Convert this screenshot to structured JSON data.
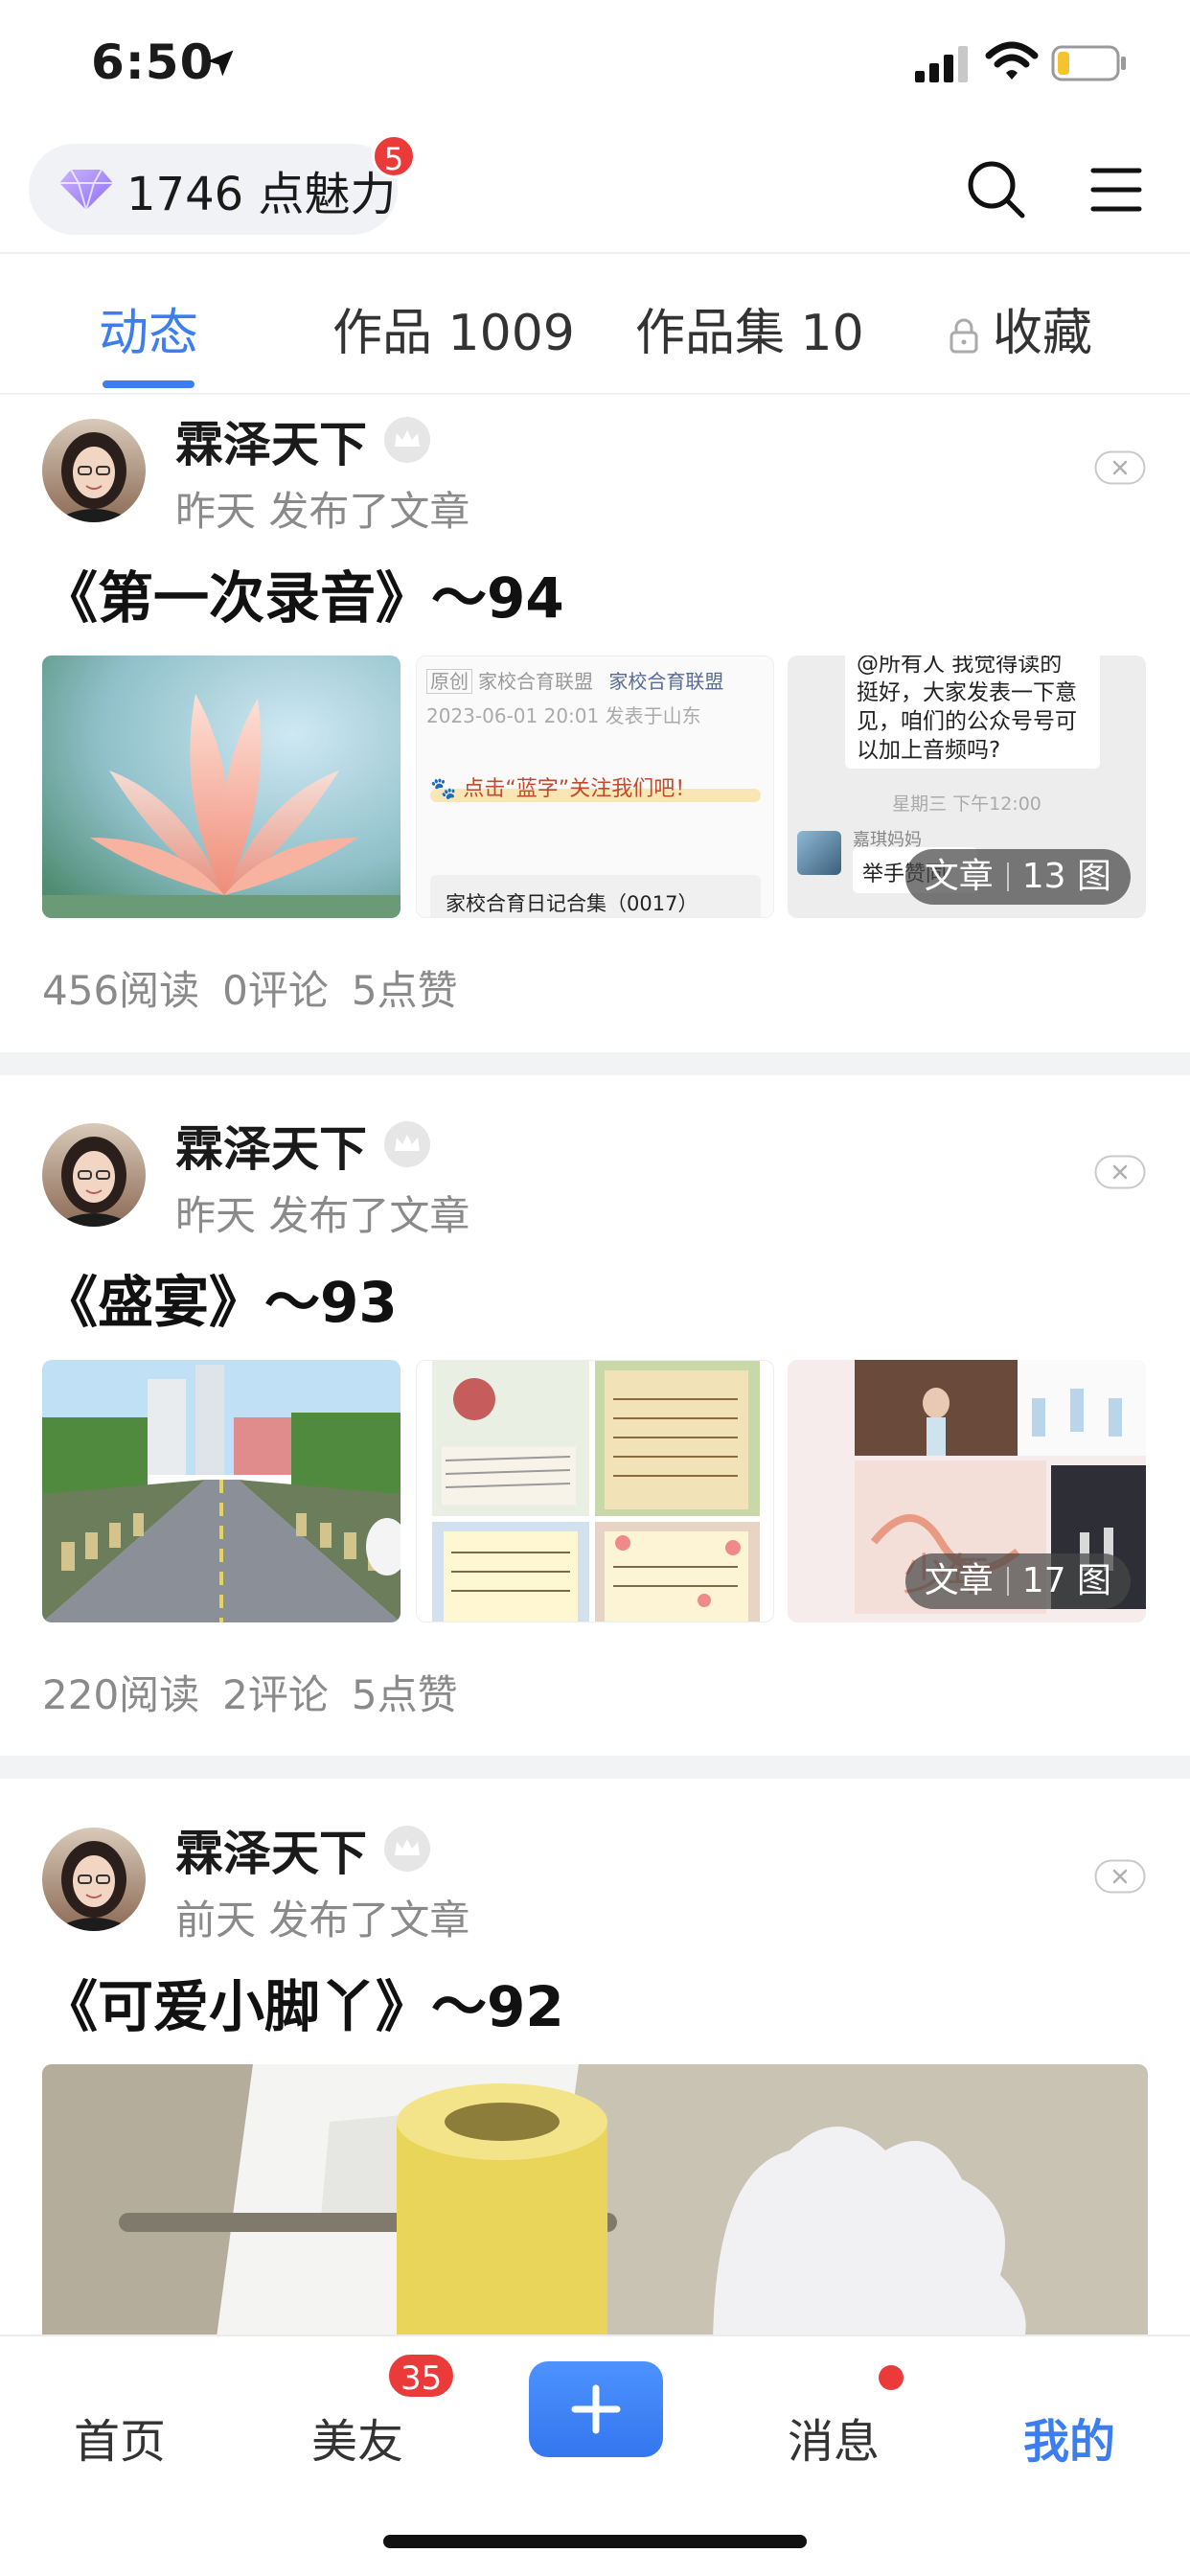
{
  "status_bar": {
    "time": "6:50"
  },
  "header": {
    "charm_text": "1746 点魅力",
    "charm_badge": "5"
  },
  "tabs": [
    {
      "label": "动态",
      "active": true
    },
    {
      "label": "作品 1009",
      "active": false
    },
    {
      "label": "作品集 10",
      "active": false
    },
    {
      "label": "收藏",
      "active": false,
      "locked": true
    }
  ],
  "posts": [
    {
      "author": "霖泽天下",
      "meta": "昨天 发布了文章",
      "title": "《第一次录音》～94",
      "thumb2": {
        "tag": "原创",
        "org": "家校合育联盟",
        "org_link": "家校合育联盟",
        "date": "2023-06-01 20:01 发表于山东",
        "follow": "点击“蓝字”关注我们吧！",
        "headline": "家校合育日记合集（0017）"
      },
      "thumb3": {
        "msg_lines": [
          "@所有人 我觉得读的",
          "挺好，大家发表一下意",
          "见，咱们的公众号号可",
          "以加上音频吗?"
        ],
        "time": "星期三 下午12:00",
        "sender": "嘉琪妈妈",
        "reply": "举手赞同"
      },
      "badge_type": "文章",
      "badge_count": "13 图",
      "stats": {
        "reads": "456阅读",
        "comments": "0评论",
        "likes": "5点赞"
      }
    },
    {
      "author": "霖泽天下",
      "meta": "昨天 发布了文章",
      "title": "《盛宴》～93",
      "badge_type": "文章",
      "badge_count": "17 图",
      "stats": {
        "reads": "220阅读",
        "comments": "2评论",
        "likes": "5点赞"
      }
    },
    {
      "author": "霖泽天下",
      "meta": "前天 发布了文章",
      "title": "《可爱小脚丫》～92"
    }
  ],
  "bottom_nav": {
    "home": "首页",
    "friends": "美友",
    "friends_badge": "35",
    "messages": "消息",
    "mine": "我的"
  },
  "colors": {
    "accent": "#3c7ef0",
    "badge_red": "#ea3a3a",
    "meta_gray": "#8a8a8a",
    "divider": "#f2f3f5"
  }
}
